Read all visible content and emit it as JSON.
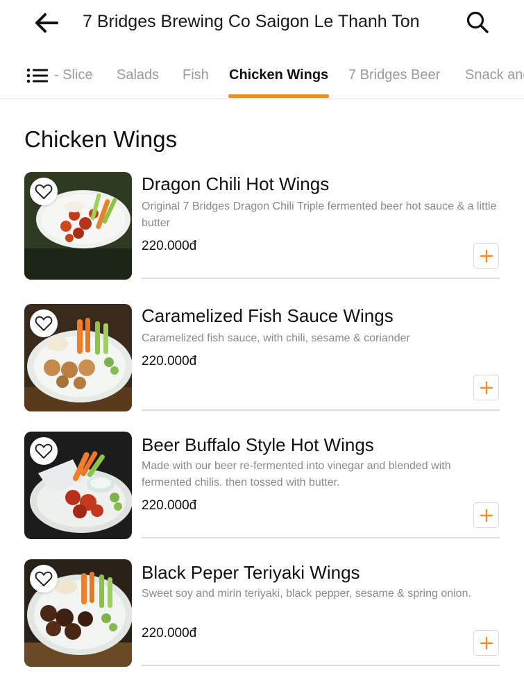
{
  "header": {
    "title": "7 Bridges Brewing Co Saigon Le Thanh Ton",
    "back_icon": "arrow-left-icon",
    "search_icon": "search-icon"
  },
  "tabs": {
    "menu_icon": "list-menu-icon",
    "items": [
      {
        "label": "- Slice",
        "active": false
      },
      {
        "label": "Salads",
        "active": false
      },
      {
        "label": "Fish",
        "active": false
      },
      {
        "label": "Chicken Wings",
        "active": true
      },
      {
        "label": "7 Bridges Beer",
        "active": false
      },
      {
        "label": "Snack and",
        "active": false
      }
    ]
  },
  "section": {
    "title": "Chicken Wings"
  },
  "items": [
    {
      "name": "Dragon Chili Hot Wings",
      "description": "Original 7 Bridges Dragon Chili Triple fermented beer hot sauce & a little butter",
      "price": "220.000đ"
    },
    {
      "name": "Caramelized Fish Sauce Wings",
      "description": "Caramelized fish sauce, with chili, sesame & coriander",
      "price": "220.000đ"
    },
    {
      "name": "Beer Buffalo Style Hot Wings",
      "description": "Made with our beer re-fermented into vinegar and blended with fermented chilis. then tossed with butter.",
      "price": "220.000đ"
    },
    {
      "name": "Black Peper Teriyaki Wings",
      "description": "Sweet soy and mirin teriyaki, black pepper, sesame & spring onion.",
      "price": "220.000đ"
    }
  ],
  "colors": {
    "accent": "#f58a1f",
    "inactive_tab": "#9a9a9a",
    "description": "#8a8a8a"
  }
}
